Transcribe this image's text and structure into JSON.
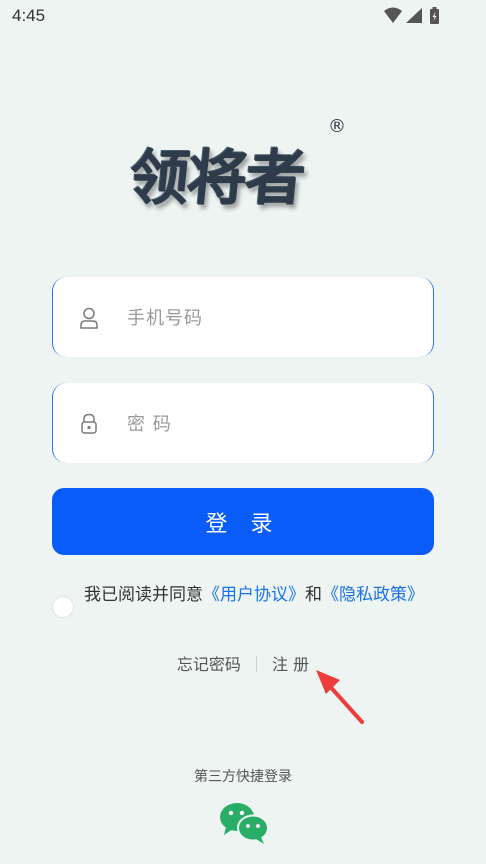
{
  "status_bar": {
    "time": "4:45"
  },
  "logo": {
    "text": "领将者",
    "registered_mark": "®"
  },
  "phone_field": {
    "placeholder": "手机号码",
    "value": ""
  },
  "password_field": {
    "placeholder": "密 码",
    "value": ""
  },
  "login_button": {
    "label": "登 录"
  },
  "agreement": {
    "prefix": "我已阅读并同意",
    "user_agreement": "《用户协议》",
    "connector": "和",
    "privacy_policy": "《隐私政策》",
    "checked": false
  },
  "links": {
    "forgot_password": "忘记密码",
    "register": "注 册"
  },
  "third_party": {
    "label": "第三方快捷登录"
  },
  "colors": {
    "primary": "#0a5cf9",
    "link": "#1a73e8",
    "background": "#eef4f2",
    "arrow": "#ee3b3b",
    "wechat": "#2aae67"
  },
  "icons": {
    "phone_field": "user-icon",
    "password_field": "lock-icon",
    "third_party": "wechat-icon"
  }
}
